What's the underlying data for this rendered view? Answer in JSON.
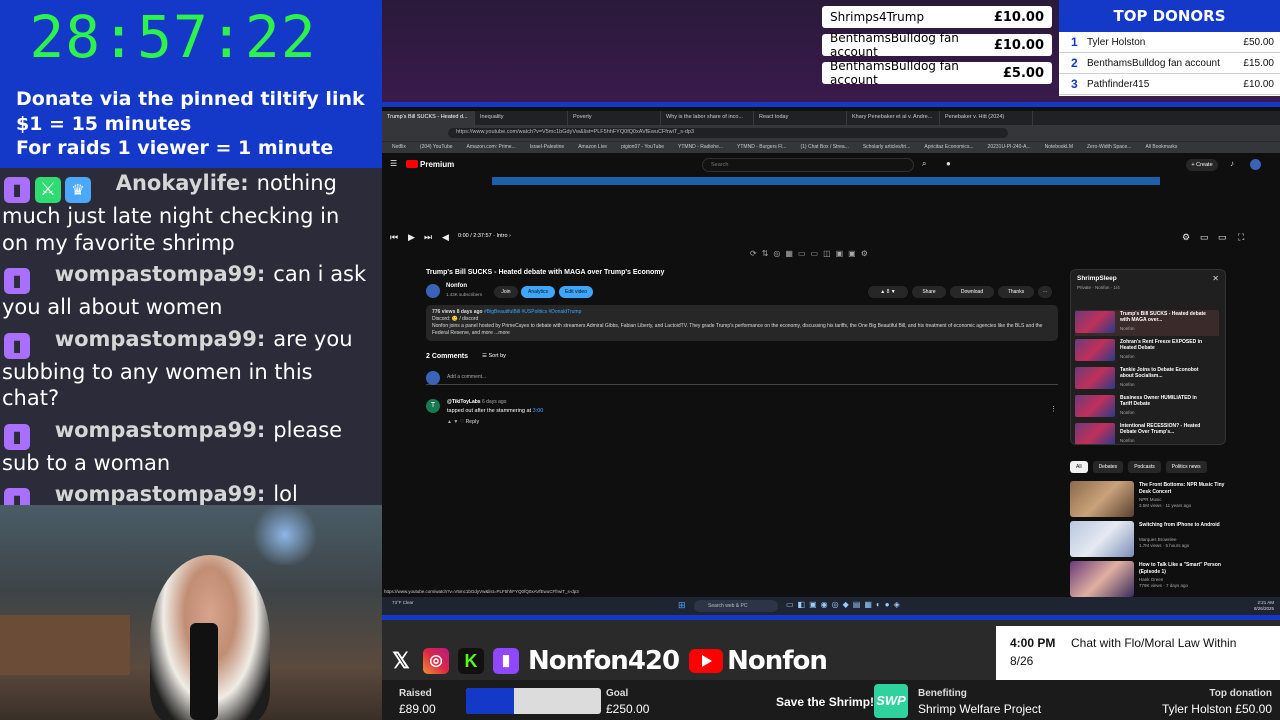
{
  "timer": "28:57:22",
  "donate_info": {
    "line1": "Donate via the pinned tiltify link",
    "line2": "$1 = 15 minutes",
    "line3": "For raids 1 viewer = 1 minute"
  },
  "chat": [
    {
      "user": "Anokaylife:",
      "text": "nothing much just late night checking in on my favorite shrimp"
    },
    {
      "user": "wompastompa99:",
      "text": "can i ask you all about women"
    },
    {
      "user": "wompastompa99:",
      "text": "are you subbing to any women in this chat?"
    },
    {
      "user": "wompastompa99:",
      "text": "please sub to a woman"
    },
    {
      "user": "wompastompa99:",
      "text": "lol"
    }
  ],
  "recent_donations": [
    {
      "name": "Shrimps4Trump",
      "amount": "£10.00"
    },
    {
      "name": "BenthamsBulldog fan account",
      "amount": "£10.00"
    },
    {
      "name": "BenthamsBulldog fan account",
      "amount": "£5.00"
    }
  ],
  "top_donors": {
    "title": "TOP DONORS",
    "rows": [
      {
        "rank": "1",
        "name": "Tyler Holston",
        "amount": "£50.00"
      },
      {
        "rank": "2",
        "name": "BenthamsBulldog fan account",
        "amount": "£15.00"
      },
      {
        "rank": "3",
        "name": "Pathfinder415",
        "amount": "£10.00"
      }
    ]
  },
  "browser": {
    "tabs": [
      "Trump's Bill SUCKS - Heated d...",
      "Inequality",
      "Poverty",
      "Why is the labor share of inco...",
      "React today",
      "Khary Penebaker et al v. Andre...",
      "Penebaker v. Hitt (2024)"
    ],
    "url": "https://www.youtube.com/watch?v=V5mc1bGdyVw&list=PLF5hhFYQ0fQ0xAVfEwuCFfrwiT_s-dp3",
    "bookmarks": [
      "Netflix",
      "(204) YouTube",
      "Amazon.com: Prime...",
      "Israel-Palestine",
      "Amazon Live",
      "pigion07 - YouTube",
      "YTMND - Radiohe...",
      "YTMND - Burgers Fl...",
      "(1) Chat Box / Strea...",
      "Scholarly articles/tri...",
      "Apricitaz Economics...",
      "20231U-PI-240-A...",
      "NotebookLM",
      "Zero-Width Space...",
      "All Bookmarks"
    ]
  },
  "youtube": {
    "logo": "Premium",
    "search_placeholder": "Search",
    "create": "+ Create",
    "player_time": "0:00 / 2:37:57 · Intro ›",
    "video_title": "Trump's Bill SUCKS - Heated debate with MAGA over Trump's Economy",
    "channel": "Nonfon",
    "subscribers": "1.43K subscribers",
    "join": "Join",
    "analytics": "Analytics",
    "edit_video": "Edit video",
    "likes": "8",
    "share": "Share",
    "download": "Download",
    "thanks": "Thanks",
    "desc_views": "776 views  8 days ago",
    "desc_tags": "#BigBeautifulBill #USPolitics #DonaldTrump",
    "desc_discord": "Discord: 🙂 / discord",
    "desc_body": "Nonfon joins a panel hosted by PrimeCayes to debate with streamers Admiral Gibbs, Fabian Liberty, and LactoidTV. They grade Trump's performance on the economy, discussing his tariffs, the One Big Beautiful Bill, and his treatment of economic agencies like the BLS and the Federal Reserve, and more  ...more",
    "comments_count": "2 Comments",
    "sort_by": "Sort by",
    "add_comment": "Add a comment...",
    "comment": {
      "author": "@TikiToyLabs",
      "time": "6 days ago",
      "text": "tapped out after the stammering at ",
      "timestamp": "3:00",
      "reply": "Reply"
    },
    "playlist": {
      "title": "ShrimpSleep",
      "subtitle": "Private · Nonfon · 1/4",
      "items": [
        {
          "title": "Trump's Bill SUCKS - Heated debate with MAGA over...",
          "channel": "Nonfon"
        },
        {
          "title": "Zohran's Rent Freeze EXPOSED in Heated Debate",
          "channel": "Nonfon"
        },
        {
          "title": "Tankie Joins to Debate Econobot about Socialism...",
          "channel": "Nonfon"
        },
        {
          "title": "Business Owner HUMILIATED in Tariff Debate",
          "channel": "Nonfon"
        },
        {
          "title": "Intentional RECESSION? - Heated Debate Over Trump's...",
          "channel": "Nonfon"
        }
      ]
    },
    "chips": [
      "All",
      "Debates",
      "Podcasts",
      "Politics news"
    ],
    "recommendations": [
      {
        "title": "The Front Bottoms: NPR Music Tiny Desk Concert",
        "channel": "NPR Music",
        "meta": "3.5M views · 11 years ago",
        "duration": "15:39"
      },
      {
        "title": "Switching from iPhone to Android",
        "channel": "Marques Brownlee",
        "meta": "1.7M views · 5 hours ago",
        "duration": "9:06"
      },
      {
        "title": "How to Talk Like a \"Smart\" Person (Episode 1)",
        "channel": "Hank Green",
        "meta": "779K views · 7 days ago",
        "duration": "8:44"
      }
    ]
  },
  "taskbar": {
    "weather": "73°F Clear",
    "search": "Search web & PC",
    "time": "2:21 AM",
    "date": "8/26/2025"
  },
  "socials": {
    "twitch": "Nonfon420",
    "youtube": "Nonfon"
  },
  "schedule": {
    "time": "4:00 PM",
    "date": "8/26",
    "title": "Chat with Flo/Moral Law Within"
  },
  "fundraiser": {
    "raised_label": "Raised",
    "raised": "£89.00",
    "goal_label": "Goal",
    "goal": "£250.00",
    "progress_fraction": 0.356,
    "save_shrimp": "Save the Shrimp!",
    "benefiting_label": "Benefiting",
    "benefiting": "Shrimp Welfare Project",
    "top_label": "Top donation",
    "top": "Tyler Holston £50.00",
    "logo_text": "SWP"
  },
  "colors": {
    "overlay_blue": "#1438c8",
    "timer_green": "#2cf24a",
    "chat_bg": "#2b2b3a",
    "twitch_purple": "#a970ff",
    "youtube_red": "#ff0000",
    "swp_teal": "#2fd19c"
  }
}
